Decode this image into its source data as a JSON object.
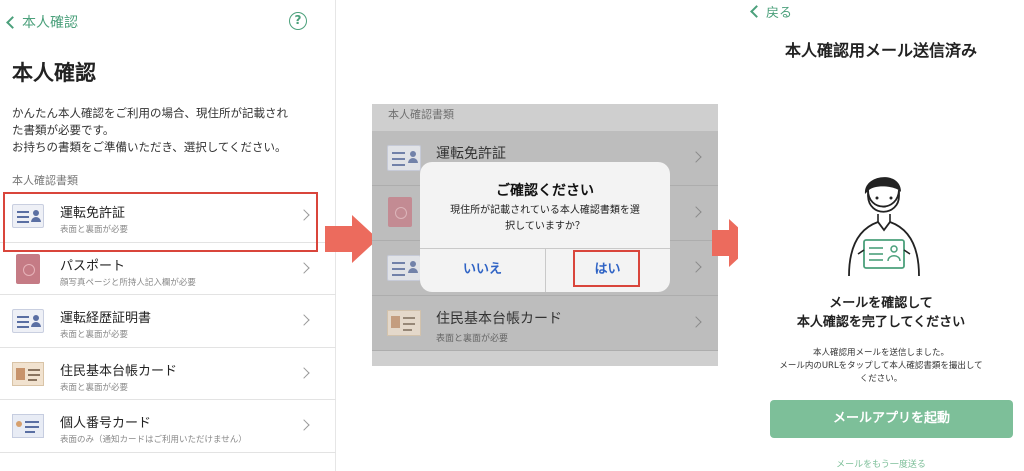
{
  "panel1": {
    "back_label": "本人確認",
    "help_icon": "?",
    "title": "本人確認",
    "description_line1": "かんたん本人確認をご利用の場合、現住所が記載され",
    "description_line2": "た書類が必要です。",
    "description_line3": "お持ちの書類をご準備いただき、選択してください。",
    "section_label": "本人確認書類",
    "items": [
      {
        "label": "運転免許証",
        "sub": "表面と裏面が必要",
        "icon": "license-card-icon"
      },
      {
        "label": "パスポート",
        "sub": "顔写真ページと所持人記入欄が必要",
        "icon": "passport-icon"
      },
      {
        "label": "運転経歴証明書",
        "sub": "表面と裏面が必要",
        "icon": "license-card-icon"
      },
      {
        "label": "住民基本台帳カード",
        "sub": "表面と裏面が必要",
        "icon": "resident-card-icon"
      },
      {
        "label": "個人番号カード",
        "sub": "表面のみ（通知カードはご利用いただけません）",
        "icon": "mynumber-card-icon"
      }
    ]
  },
  "panel2": {
    "section_label": "本人確認書類",
    "items": [
      {
        "label": "運転免許証",
        "sub": ""
      },
      {
        "label": "",
        "sub": ""
      },
      {
        "label": "",
        "sub": ""
      },
      {
        "label": "住民基本台帳カード",
        "sub": "表面と裏面が必要"
      }
    ],
    "dialog": {
      "title": "ご確認ください",
      "message_line1": "現住所が記載されている本人確認書類を選",
      "message_line2": "択していますか？",
      "no_label": "いいえ",
      "yes_label": "はい"
    }
  },
  "panel3": {
    "back_label": "戻る",
    "title": "本人確認用メール送信済み",
    "heading_line1": "メールを確認して",
    "heading_line2": "本人確認を完了してください",
    "body_line1": "本人確認用メールを送信しました。",
    "body_line2": "メール内のURLをタップして本人確認書類を撮出して",
    "body_line3": "ください。",
    "button_label": "メールアプリを起動",
    "resend_label": "メールをもう一度送る"
  },
  "colors": {
    "accent_green": "#4ba07b",
    "button_green": "#7dbf99",
    "highlight_red": "#d9453b",
    "arrow_red": "#ec6b5d",
    "dialog_blue": "#2f63c5"
  }
}
